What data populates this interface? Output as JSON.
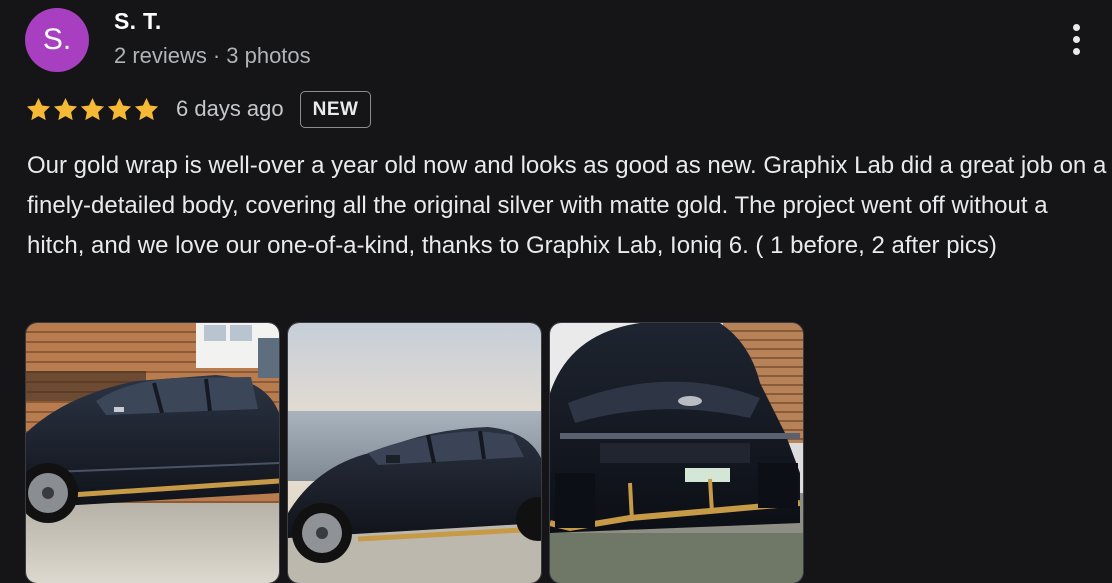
{
  "reviewer": {
    "initial": "S.",
    "name": "S. T.",
    "reviews": "2 reviews",
    "separator": "·",
    "photos": "3 photos",
    "avatar_color": "#a73fc0"
  },
  "review": {
    "rating": 5,
    "rating_max": 5,
    "star_color": "#f5b936",
    "date": "6 days ago",
    "badge": "NEW",
    "text": "Our gold wrap is well-over a year old now and looks as good as new. Graphix Lab did a great job on a finely-detailed body, covering all the original silver with matte gold. The project went off without a hitch, and we love our one-of-a-kind, thanks to Graphix Lab, Ioniq 6. ( 1 before, 2 after pics)"
  },
  "icons": {
    "more": "more-vert-icon",
    "star": "star-icon"
  },
  "photos": [
    {
      "subject": "black sedan side view with gold trim, beside house"
    },
    {
      "subject": "black sedan side view with gold trim, ocean backdrop"
    },
    {
      "subject": "black sedan rear view with gold trim, on gravel"
    }
  ]
}
